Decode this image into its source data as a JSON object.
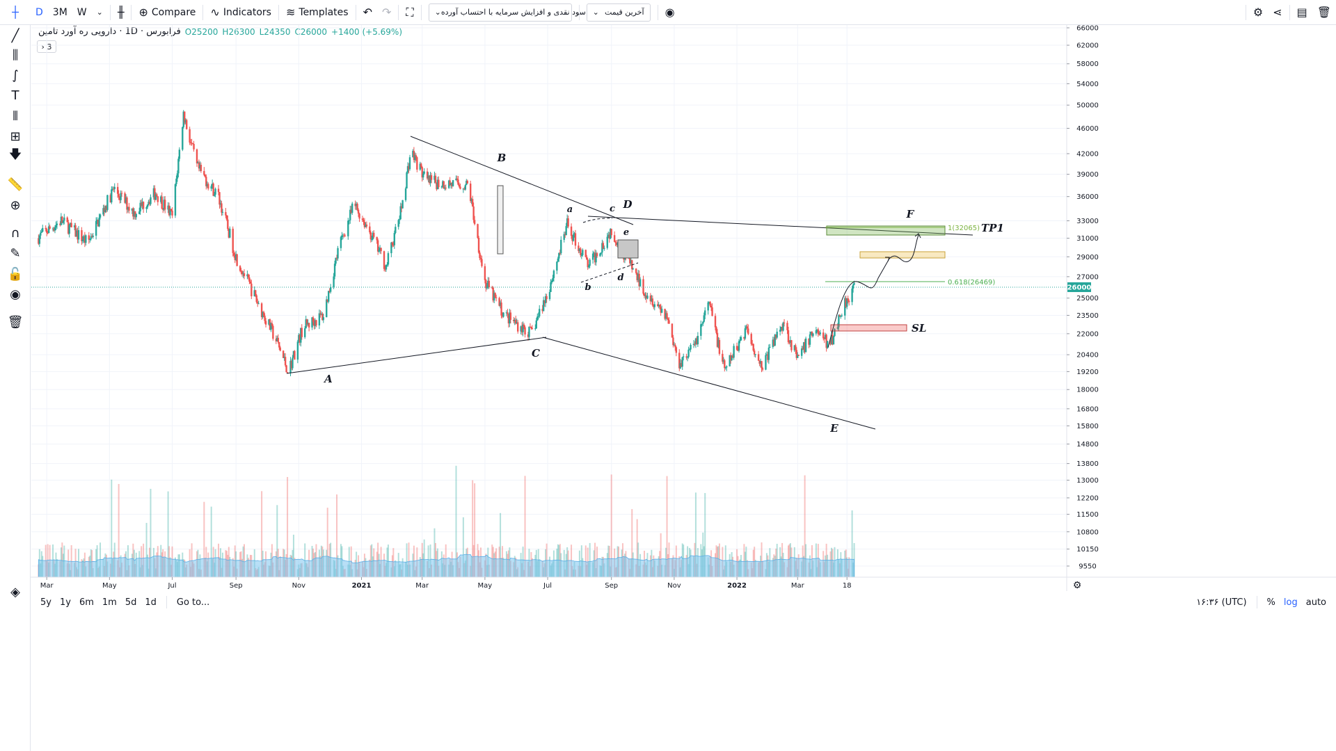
{
  "toolbar": {
    "interval_d": "D",
    "interval_3m": "3M",
    "interval_w": "W",
    "compare_label": "Compare",
    "indicators_label": "Indicators",
    "templates_label": "Templates",
    "strategy_select": "سود نقدی و افزایش سرمایه با احتساب آورده",
    "price_select": "آخرین قیمت"
  },
  "legend": {
    "symbol": "فرابورس · 1D · دارویی ره آورد تامین",
    "open": "O25200",
    "high": "H26300",
    "low": "L24350",
    "close": "C26000",
    "change": "+1400 (+5.69%)",
    "collapsed_count": "3"
  },
  "bottom": {
    "ranges": [
      "5y",
      "1y",
      "6m",
      "1m",
      "5d",
      "1d"
    ],
    "goto": "Go to...",
    "time": "۱۶:۳۶ (UTC)",
    "percent": "%",
    "log": "log",
    "auto": "auto"
  },
  "colors": {
    "up": "#26a69a",
    "down": "#ef5350",
    "volume_area": "#7ec4ef",
    "grid": "#f0f3fa",
    "accent": "#2962ff"
  },
  "chart_data": {
    "type": "candlestick",
    "scale": "log",
    "last_price": "26000",
    "x_ticks": [
      "Mar",
      "May",
      "Jul",
      "Sep",
      "Nov",
      "2021",
      "Mar",
      "May",
      "Jul",
      "Sep",
      "Nov",
      "2022",
      "Mar",
      "18"
    ],
    "y_ticks": [
      "66000",
      "62000",
      "58000",
      "54000",
      "50000",
      "46000",
      "42000",
      "39000",
      "36000",
      "33000",
      "31000",
      "29000",
      "27000",
      "25000",
      "23500",
      "22000",
      "20400",
      "19200",
      "18000",
      "16800",
      "15800",
      "14800",
      "13800",
      "13000",
      "12200",
      "11500",
      "10800",
      "10150",
      "9550"
    ],
    "price_path": [
      {
        "d": "2020-02-20",
        "p": 31000
      },
      {
        "d": "2020-03-15",
        "p": 33000
      },
      {
        "d": "2020-04-10",
        "p": 30500
      },
      {
        "d": "2020-05-05",
        "p": 37000
      },
      {
        "d": "2020-05-25",
        "p": 34000
      },
      {
        "d": "2020-06-15",
        "p": 36500
      },
      {
        "d": "2020-07-01",
        "p": 33500
      },
      {
        "d": "2020-07-12",
        "p": 48500
      },
      {
        "d": "2020-07-25",
        "p": 40000
      },
      {
        "d": "2020-08-15",
        "p": 36000
      },
      {
        "d": "2020-09-01",
        "p": 29000
      },
      {
        "d": "2020-09-20",
        "p": 25000
      },
      {
        "d": "2020-10-10",
        "p": 21500
      },
      {
        "d": "2020-10-22",
        "p": 19200
      },
      {
        "d": "2020-11-05",
        "p": 22500
      },
      {
        "d": "2020-11-25",
        "p": 23500
      },
      {
        "d": "2020-12-10",
        "p": 30000
      },
      {
        "d": "2020-12-25",
        "p": 35000
      },
      {
        "d": "2021-01-08",
        "p": 32000
      },
      {
        "d": "2021-01-25",
        "p": 28000
      },
      {
        "d": "2021-02-08",
        "p": 34000
      },
      {
        "d": "2021-02-18",
        "p": 42500
      },
      {
        "d": "2021-03-05",
        "p": 38000
      },
      {
        "d": "2021-04-15",
        "p": 37500
      },
      {
        "d": "2021-05-01",
        "p": 26500
      },
      {
        "d": "2021-05-20",
        "p": 23500
      },
      {
        "d": "2021-06-15",
        "p": 22000
      },
      {
        "d": "2021-07-01",
        "p": 25500
      },
      {
        "d": "2021-07-20",
        "p": 32500
      },
      {
        "d": "2021-08-10",
        "p": 28000
      },
      {
        "d": "2021-09-01",
        "p": 32000
      },
      {
        "d": "2021-09-15",
        "p": 29000
      },
      {
        "d": "2021-10-01",
        "p": 26000
      },
      {
        "d": "2021-10-25",
        "p": 23500
      },
      {
        "d": "2021-11-05",
        "p": 19800
      },
      {
        "d": "2021-11-20",
        "p": 21000
      },
      {
        "d": "2021-12-05",
        "p": 24500
      },
      {
        "d": "2021-12-20",
        "p": 19200
      },
      {
        "d": "2022-01-10",
        "p": 22500
      },
      {
        "d": "2022-01-25",
        "p": 19500
      },
      {
        "d": "2022-02-15",
        "p": 23000
      },
      {
        "d": "2022-03-01",
        "p": 20000
      },
      {
        "d": "2022-03-18",
        "p": 22500
      },
      {
        "d": "2022-04-01",
        "p": 21000
      },
      {
        "d": "2022-04-15",
        "p": 24500
      },
      {
        "d": "2022-04-25",
        "p": 26000
      }
    ],
    "annotations": {
      "wave_labels": [
        "A",
        "B",
        "C",
        "D",
        "E",
        "F",
        "a",
        "b",
        "c",
        "d",
        "e"
      ],
      "fib_618": "0.618(26469)",
      "fib_1": "1(32065)",
      "tp_label": "TP1",
      "sl_label": "SL"
    }
  }
}
